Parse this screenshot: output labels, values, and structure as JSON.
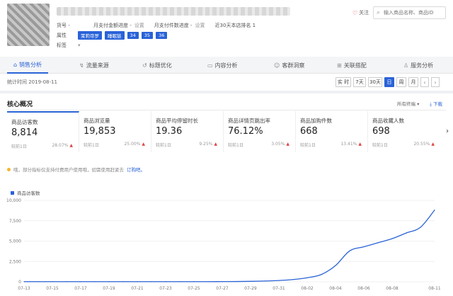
{
  "header": {
    "meta_label_1": "货号 -",
    "meta_text_1a": "月支付金额进度 -",
    "meta_link_1a": "设置",
    "meta_text_1b": "月支付件数进度 -",
    "meta_link_1b": "设置",
    "meta_text_1c": "近30天本店排名 1",
    "meta_label_2": "属性",
    "tags": [
      "茉莉帝罗",
      "睡眠链",
      "34",
      "35",
      "36"
    ],
    "meta_label_3": "标签",
    "follow_label": "关注",
    "search_placeholder": "输入商品名称、商品ID"
  },
  "tabs": [
    {
      "label": "销售分析",
      "icon": "chart-icon"
    },
    {
      "label": "流量来源",
      "icon": "traffic-icon"
    },
    {
      "label": "标题优化",
      "icon": "tag-icon"
    },
    {
      "label": "内容分析",
      "icon": "doc-icon"
    },
    {
      "label": "客群洞察",
      "icon": "users-icon"
    },
    {
      "label": "关联搭配",
      "icon": "link-icon"
    },
    {
      "label": "服务分析",
      "icon": "service-icon"
    }
  ],
  "timebar": {
    "stat_time": "统计时间 2019-08-11",
    "periods": [
      "实 时",
      "7天",
      "30天",
      "日",
      "周",
      "月"
    ],
    "active_period": "日"
  },
  "panel": {
    "title": "核心概况",
    "channels": "所有终端",
    "download": "下载"
  },
  "cards": [
    {
      "name": "商品访客数",
      "value": "8,814",
      "cmp": "较前1日",
      "pct": "28.07%"
    },
    {
      "name": "商品浏览量",
      "value": "19,853",
      "cmp": "较前1日",
      "pct": "25.00%"
    },
    {
      "name": "商品平均停留时长",
      "value": "19.36",
      "cmp": "较前1日",
      "pct": "9.25%"
    },
    {
      "name": "商品详情页跳出率",
      "value": "76.12%",
      "cmp": "较前1日",
      "pct": "3.05%"
    },
    {
      "name": "商品加购件数",
      "value": "668",
      "cmp": "较前1日",
      "pct": "13.41%"
    },
    {
      "name": "商品收藏人数",
      "value": "698",
      "cmp": "较前1日",
      "pct": "20.55%"
    }
  ],
  "notice": {
    "text": "哦，部分指标仅支持付费用户使用哦，如需使用赶紧去",
    "link": "订购吧。"
  },
  "colors": {
    "accent": "#2a63d6",
    "up": "#e04343"
  },
  "chart_data": {
    "type": "line",
    "series": [
      {
        "name": "商品访客数",
        "x": [
          "07-13",
          "07-14",
          "07-15",
          "07-16",
          "07-17",
          "07-18",
          "07-19",
          "07-20",
          "07-21",
          "07-22",
          "07-23",
          "07-24",
          "07-25",
          "07-26",
          "07-27",
          "07-28",
          "07-29",
          "07-30",
          "07-31",
          "08-01",
          "08-02",
          "08-03",
          "08-04",
          "08-05",
          "08-06",
          "08-07",
          "08-08",
          "08-09",
          "08-10",
          "08-11"
        ],
        "values": [
          20,
          20,
          20,
          20,
          20,
          20,
          20,
          20,
          20,
          20,
          20,
          20,
          20,
          20,
          30,
          40,
          60,
          100,
          160,
          280,
          500,
          900,
          2000,
          3800,
          4300,
          4800,
          5300,
          6000,
          6700,
          8814
        ]
      }
    ],
    "xticks": [
      "07-13",
      "07-15",
      "07-17",
      "07-19",
      "07-21",
      "07-23",
      "07-25",
      "07-27",
      "07-29",
      "07-31",
      "08-02",
      "08-04",
      "08-06",
      "08-08",
      "08-11"
    ],
    "yticks": [
      "0",
      "2,500",
      "5,000",
      "7,500",
      "10,000"
    ],
    "ylim": [
      0,
      10000
    ],
    "grid": true,
    "legend": "top-left"
  }
}
